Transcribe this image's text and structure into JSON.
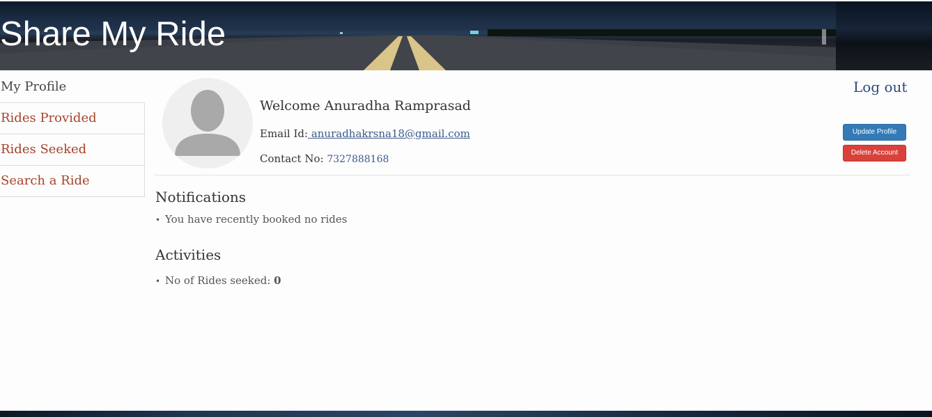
{
  "header": {
    "title": "Share My Ride"
  },
  "sidebar": {
    "items": [
      {
        "label": "My Profile",
        "active": true
      },
      {
        "label": "Rides Provided",
        "active": false
      },
      {
        "label": "Rides Seeked",
        "active": false
      },
      {
        "label": "Search a Ride",
        "active": false
      }
    ]
  },
  "profile": {
    "welcome": "Welcome Anuradha Ramprasad",
    "email_label": "Email Id:",
    "email": " anuradhakrsna18@gmail.com",
    "contact_label": "Contact No:",
    "contact": "7327888168"
  },
  "actions": {
    "logout": "Log out",
    "update": "Update Profile",
    "delete": "Delete Account"
  },
  "notifications": {
    "title": "Notifications",
    "items": [
      "You have recently booked no rides"
    ]
  },
  "activities": {
    "title": "Activities",
    "rides_seeked_label": "No of Rides seeked:",
    "rides_seeked_count": "0"
  },
  "colors": {
    "link": "#a5432c",
    "primary": "#337ab7",
    "danger": "#d9413b"
  }
}
